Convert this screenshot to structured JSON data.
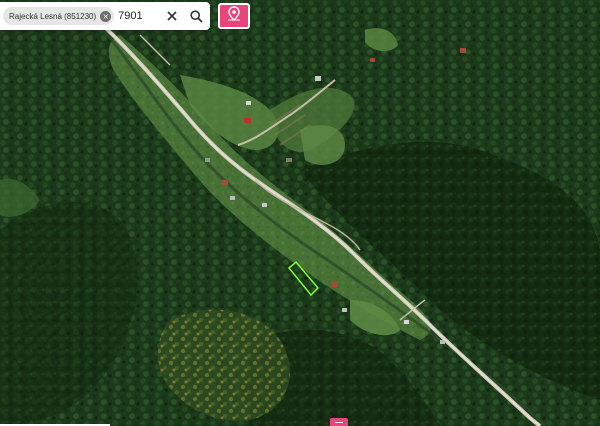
{
  "search": {
    "chip_label": "Rajecká Lesná (851230)",
    "chip_close": "×",
    "query": "7901",
    "clear_icon": "close-icon",
    "search_icon": "search-icon"
  },
  "map": {
    "type": "satellite",
    "highlighted_parcel_color": "#7cff3a",
    "pin_button_color": "#e8457a",
    "pin_icon": "map-pin-icon"
  }
}
